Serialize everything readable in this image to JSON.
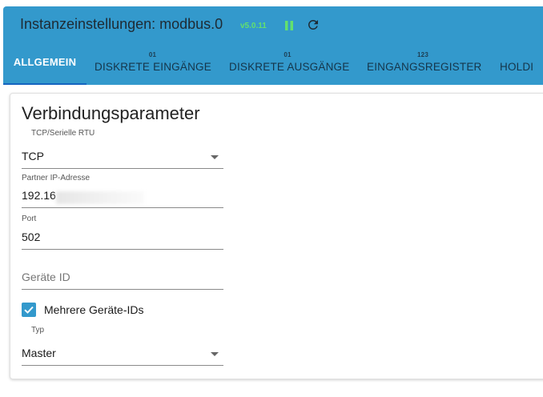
{
  "header": {
    "title": "Instanzeinstellungen: modbus.0",
    "version": "v5.0.11",
    "pause_icon": "pause-icon",
    "reload_icon": "reload-icon",
    "background_color": "#3399cc"
  },
  "tabs": [
    {
      "label": "ALLGEMEIN",
      "count": "",
      "active": true
    },
    {
      "label": "DISKRETE EINGÄNGE",
      "count": "01"
    },
    {
      "label": "DISKRETE AUSGÄNGE",
      "count": "01"
    },
    {
      "label": "EINGANGSREGISTER",
      "count": "123"
    },
    {
      "label": "HOLDI",
      "count": ""
    }
  ],
  "form": {
    "section_title": "Verbindungsparameter",
    "connection_type": {
      "label": "TCP/Serielle RTU",
      "value": "TCP"
    },
    "partner_ip": {
      "label": "Partner IP-Adresse",
      "value": "192.16"
    },
    "port": {
      "label": "Port",
      "value": "502"
    },
    "device_id": {
      "placeholder": "Geräte ID"
    },
    "multiple_ids": {
      "label": "Mehrere Geräte-IDs",
      "checked": true
    },
    "type": {
      "label": "Typ",
      "value": "Master"
    }
  }
}
